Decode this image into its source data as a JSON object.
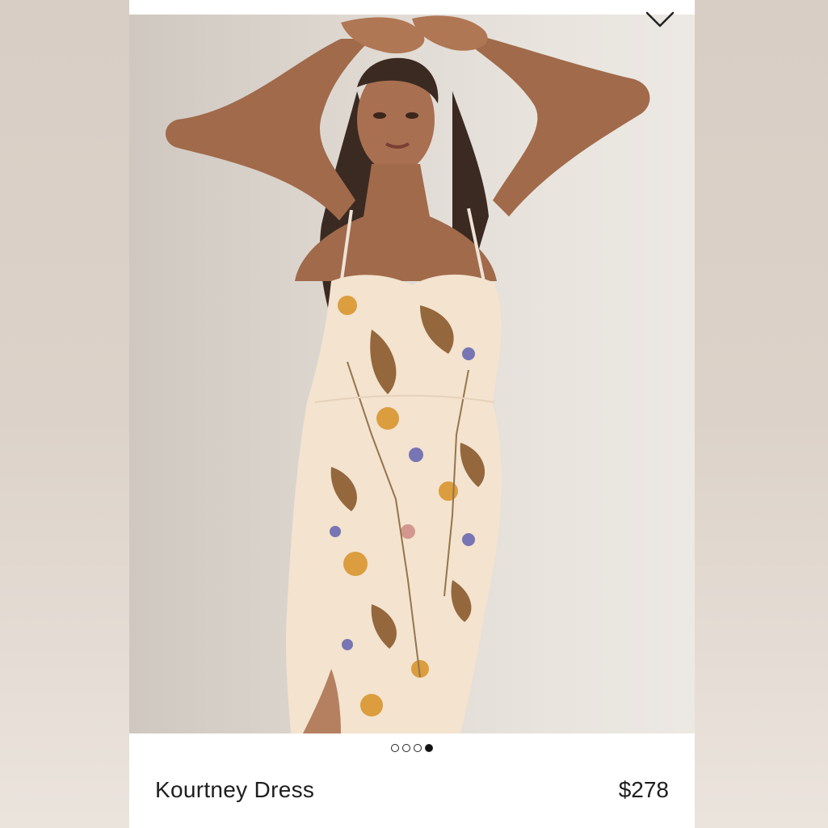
{
  "product": {
    "name": "Kourtney Dress",
    "price": "$278"
  },
  "carousel": {
    "total": 4,
    "active_index": 4
  },
  "icons": {
    "favorite": "heart-icon"
  },
  "colors": {
    "text": "#1e1e1e",
    "card": "#ffffff",
    "backdrop": "#dcd2c9"
  }
}
